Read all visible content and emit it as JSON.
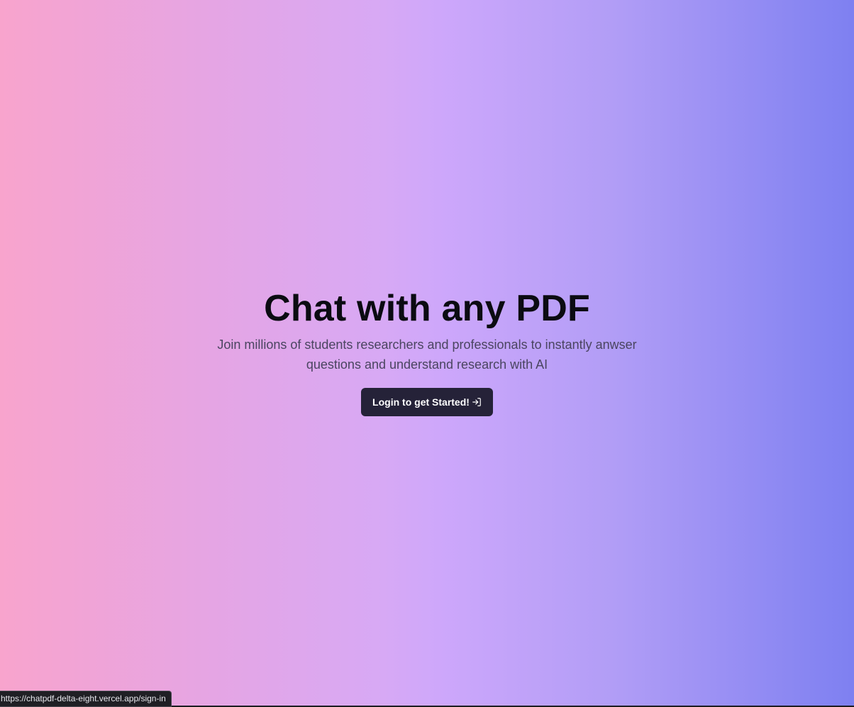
{
  "hero": {
    "title": "Chat with any PDF",
    "subtitle": "Join millions of students researchers and professionals to instantly anwser questions and understand research with AI",
    "cta_label": "Login to get Started!",
    "cta_icon": "log-in-icon"
  },
  "status_bar": {
    "link_url": "https://chatpdf-delta-eight.vercel.app/sign-in"
  },
  "colors": {
    "gradient_left": "#f8a4cd",
    "gradient_middle": "#d7a9f5",
    "gradient_right": "#7e80f1",
    "title_text": "#0b0b12",
    "subtitle_text": "#4a4560",
    "button_bg": "#252238",
    "button_text": "#ffffff"
  }
}
